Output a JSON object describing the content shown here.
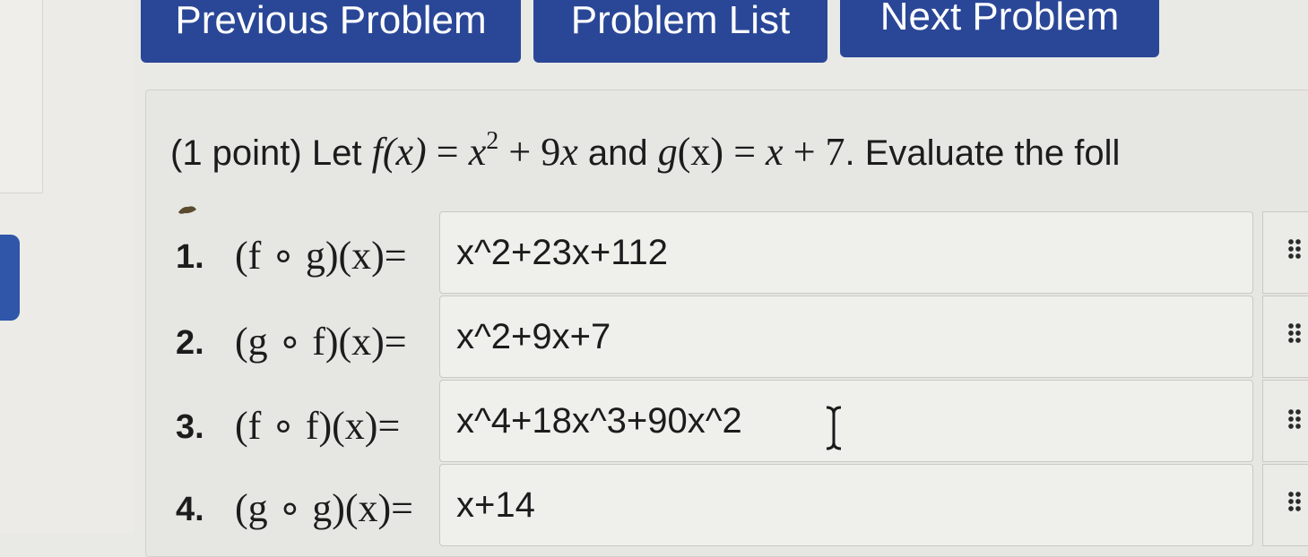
{
  "nav": {
    "previous_label": "Previous Problem",
    "list_label": "Problem List",
    "next_label": "Next Problem"
  },
  "problem": {
    "prefix": "(1 point) Let",
    "f_name": "f",
    "f_arg": "(x)",
    "eq1": "=",
    "x_var": "x",
    "exp": "2",
    "f_rest": "+ 9",
    "x_var2": "x",
    "and_text": "and",
    "g_expr": "g",
    "g_arg": "(x)",
    "eq2": "= ",
    "x_var3": "x",
    "g_rest": "+ 7",
    "suffix": ". Evaluate the foll"
  },
  "questions": [
    {
      "number": "1.",
      "label": "(f ∘ g)(x)=",
      "value": "x^2+23x+112"
    },
    {
      "number": "2.",
      "label": "(g ∘ f)(x)=",
      "value": "x^2+9x+7"
    },
    {
      "number": "3.",
      "label": "(f ∘ f)(x)=",
      "value": "x^4+18x^3+90x^2"
    },
    {
      "number": "4.",
      "label": "(g ∘ g)(x)=",
      "value": "x+14"
    }
  ],
  "colors": {
    "nav_button": "#2a4797",
    "nav_text": "#ffffff",
    "panel_bg": "#e6e6e3",
    "field_bg": "#efefec",
    "accent_tab": "#2f56a8"
  },
  "icons": {
    "cursor": "text-cursor-icon",
    "handle": "drag-handle-icon"
  }
}
